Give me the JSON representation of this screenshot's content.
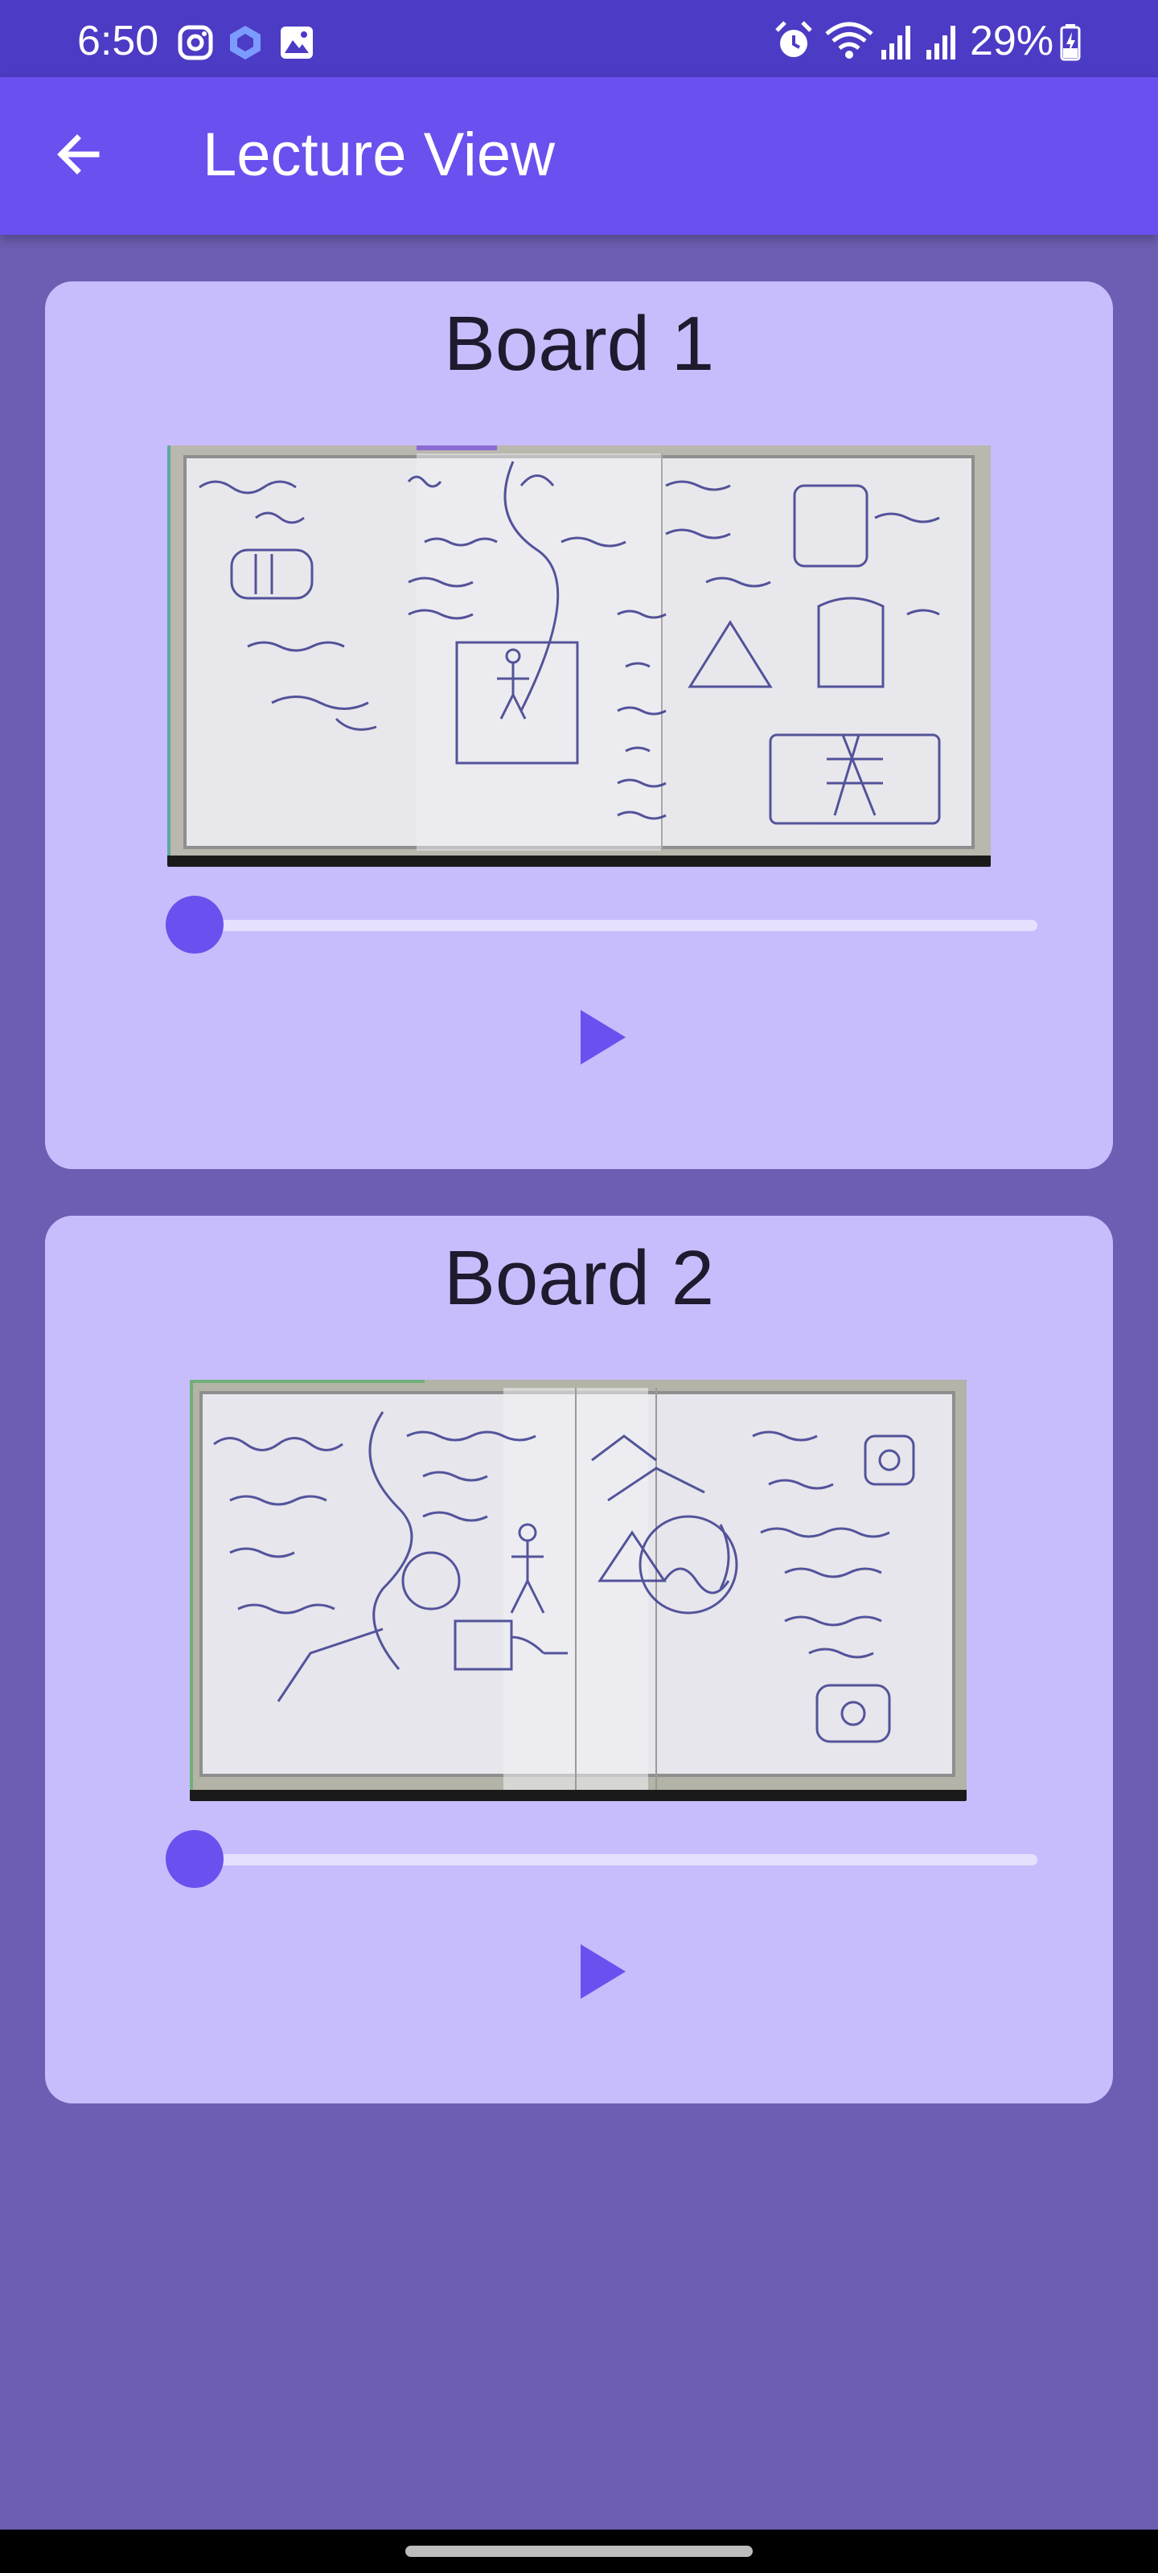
{
  "status_bar": {
    "time": "6:50",
    "battery": "29%",
    "icons": [
      "instagram-icon",
      "app-icon",
      "gallery-icon",
      "alarm-icon",
      "wifi-icon",
      "signal-icon",
      "signal-icon",
      "battery-charging-icon"
    ]
  },
  "app_bar": {
    "title": "Lecture View",
    "back_icon": "arrow-back-icon"
  },
  "boards": [
    {
      "title": "Board 1",
      "image_alt": "Whiteboard with handwritten notes",
      "progress": 0.0
    },
    {
      "title": "Board 2",
      "image_alt": "Whiteboard with handwritten notes",
      "progress": 0.0
    }
  ],
  "colors": {
    "status_bar": "#4C3BC4",
    "app_bar": "#6A50EE",
    "background": "#6E5EB3",
    "card": "#C8BDFC",
    "accent": "#6A50EE"
  }
}
